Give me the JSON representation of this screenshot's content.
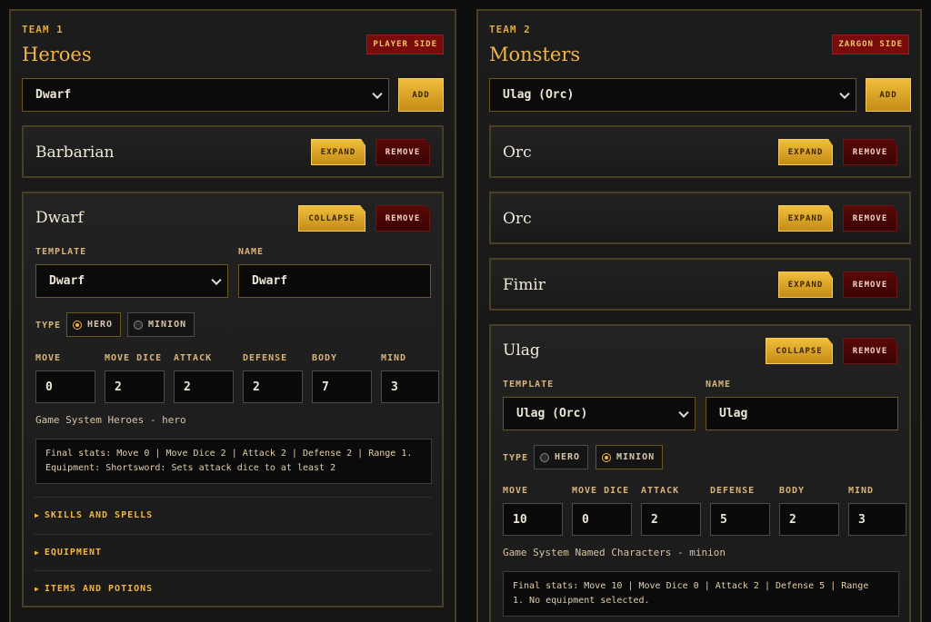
{
  "team1": {
    "label": "TEAM 1",
    "title": "Heroes",
    "badge": "PLAYER SIDE",
    "add_select_value": "Dwarf",
    "add_label": "ADD",
    "cards": [
      {
        "title": "Barbarian",
        "toggle": "EXPAND",
        "remove": "REMOVE"
      },
      {
        "title": "Dwarf",
        "toggle": "COLLAPSE",
        "remove": "REMOVE",
        "template_label": "TEMPLATE",
        "template_value": "Dwarf",
        "name_label": "NAME",
        "name_value": "Dwarf",
        "type_label": "TYPE",
        "type_options": [
          "HERO",
          "MINION"
        ],
        "type_selected": "HERO",
        "stat_labels": [
          "MOVE",
          "MOVE DICE",
          "ATTACK",
          "DEFENSE",
          "BODY",
          "MIND"
        ],
        "stat_values": [
          "0",
          "2",
          "2",
          "2",
          "7",
          "3"
        ],
        "system_text": "Game System Heroes - hero",
        "final_stats": "Final stats: Move 0 | Move Dice 2 | Attack 2 | Defense 2 | Range 1.",
        "equipment_text": "Equipment: Shortsword: Sets attack dice to at least 2",
        "sections": [
          "SKILLS AND SPELLS",
          "EQUIPMENT",
          "ITEMS AND POTIONS"
        ]
      }
    ]
  },
  "team2": {
    "label": "TEAM 2",
    "title": "Monsters",
    "badge": "ZARGON SIDE",
    "add_select_value": "Ulag (Orc)",
    "add_label": "ADD",
    "cards": [
      {
        "title": "Orc",
        "toggle": "EXPAND",
        "remove": "REMOVE"
      },
      {
        "title": "Orc",
        "toggle": "EXPAND",
        "remove": "REMOVE"
      },
      {
        "title": "Fimir",
        "toggle": "EXPAND",
        "remove": "REMOVE"
      },
      {
        "title": "Ulag",
        "toggle": "COLLAPSE",
        "remove": "REMOVE",
        "template_label": "TEMPLATE",
        "template_value": "Ulag (Orc)",
        "name_label": "NAME",
        "name_value": "Ulag",
        "type_label": "TYPE",
        "type_options": [
          "HERO",
          "MINION"
        ],
        "type_selected": "MINION",
        "stat_labels": [
          "MOVE",
          "MOVE DICE",
          "ATTACK",
          "DEFENSE",
          "BODY",
          "MIND"
        ],
        "stat_values": [
          "10",
          "0",
          "2",
          "5",
          "2",
          "3"
        ],
        "system_text": "Game System Named Characters - minion",
        "final_stats_l1": "Final stats: Move 10 | Move Dice 0 | Attack 2 | Defense 5 | Range",
        "final_stats_l2": "1. No equipment selected."
      }
    ]
  },
  "colors": {
    "accent": "#f0b545",
    "danger": "#5a0808",
    "border": "#4a3f26"
  }
}
